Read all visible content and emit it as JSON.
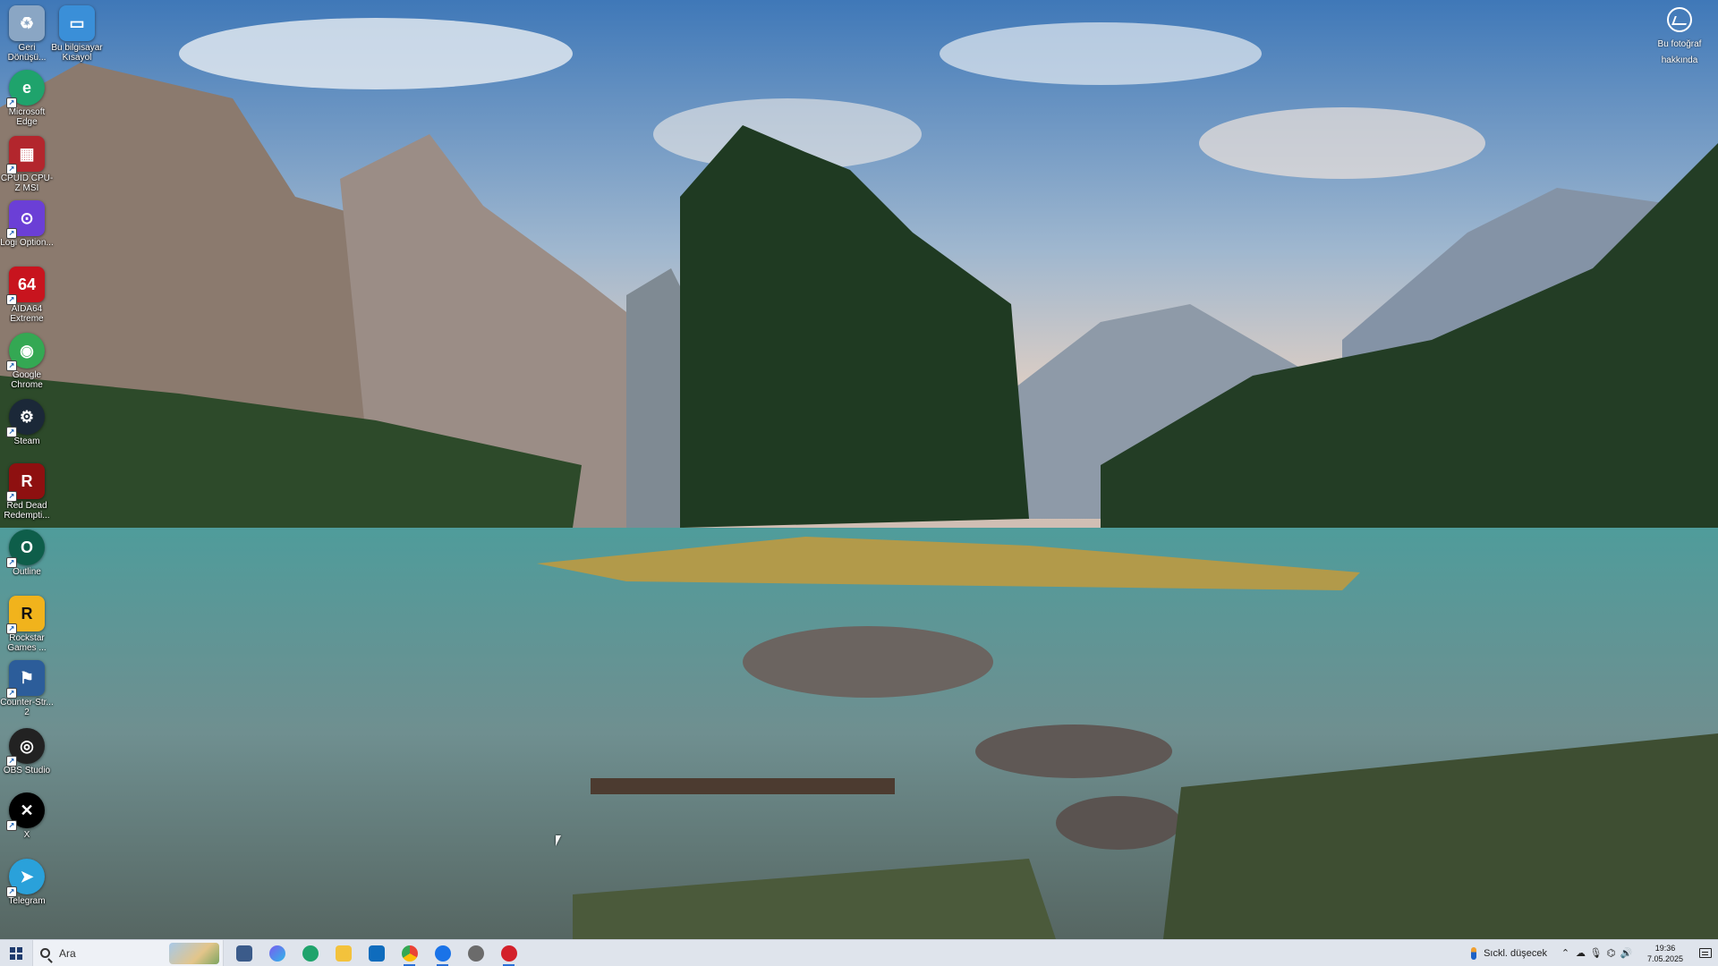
{
  "desktop": {
    "icons": [
      {
        "id": "recycle",
        "label": "Geri Dönüşü...",
        "icon": "recycle-bin-icon",
        "color": "#8aa6c4",
        "glyph": "♻"
      },
      {
        "id": "thispc",
        "label": "Bu bilgisayar Kısayol",
        "icon": "computer-icon",
        "color": "#3a8fd8",
        "glyph": "▭"
      },
      {
        "id": "edge",
        "label": "Microsoft Edge",
        "icon": "edge-icon",
        "color": "#1fa36c",
        "glyph": "e"
      },
      {
        "id": "cpuz",
        "label": "CPUID CPU-Z MSI",
        "icon": "cpuz-icon",
        "color": "#b3262d",
        "glyph": "▦"
      },
      {
        "id": "logi",
        "label": "Logi Option...",
        "icon": "logi-options-icon",
        "color": "#6b3fd6",
        "glyph": "⊙"
      },
      {
        "id": "aida",
        "label": "AIDA64 Extreme",
        "icon": "aida64-icon",
        "color": "#c8141e",
        "glyph": "64"
      },
      {
        "id": "chrome",
        "label": "Google Chrome",
        "icon": "chrome-icon",
        "color": "#34a853",
        "glyph": "◉"
      },
      {
        "id": "steam",
        "label": "Steam",
        "icon": "steam-icon",
        "color": "#1b2838",
        "glyph": "⚙"
      },
      {
        "id": "rdr",
        "label": "Red Dead Redempti...",
        "icon": "red-dead-icon",
        "color": "#8e1010",
        "glyph": "R"
      },
      {
        "id": "outline",
        "label": "Outline",
        "icon": "outline-vpn-icon",
        "color": "#0e5e4a",
        "glyph": "O"
      },
      {
        "id": "rockstar",
        "label": "Rockstar Games ...",
        "icon": "rockstar-icon",
        "color": "#f1b31c",
        "glyph": "R"
      },
      {
        "id": "cs2",
        "label": "Counter-Str... 2",
        "icon": "counter-strike-icon",
        "color": "#2c5d9a",
        "glyph": "⚑"
      },
      {
        "id": "obs",
        "label": "OBS Studio",
        "icon": "obs-icon",
        "color": "#222222",
        "glyph": "◎"
      },
      {
        "id": "x",
        "label": "X",
        "icon": "x-icon",
        "color": "#000000",
        "glyph": "✕"
      },
      {
        "id": "telegram",
        "label": "Telegram",
        "icon": "telegram-icon",
        "color": "#2aa1da",
        "glyph": "➤"
      }
    ],
    "about_photo_label": "Bu fotoğraf hakkında"
  },
  "taskbar": {
    "search_placeholder": "Ara",
    "apps": [
      {
        "name": "task-view",
        "color": "#3b5b8a"
      },
      {
        "name": "copilot",
        "color": "#7a5cf0"
      },
      {
        "name": "edge",
        "color": "#1fa36c"
      },
      {
        "name": "file-explorer",
        "color": "#f3c23c"
      },
      {
        "name": "outlook",
        "color": "#0f6cbd"
      },
      {
        "name": "chrome",
        "color": "#34a853"
      },
      {
        "name": "chrome-profile",
        "color": "#1a73e8"
      },
      {
        "name": "settings",
        "color": "#6b6b6b"
      },
      {
        "name": "red-app",
        "color": "#d3202a"
      }
    ],
    "weather_text": "Sıckl. düşecek",
    "time": "19:36",
    "date": "7.05.2025"
  },
  "colors": {
    "taskbar_bg": "#dfe4ec",
    "accent": "#2a6fd6"
  }
}
